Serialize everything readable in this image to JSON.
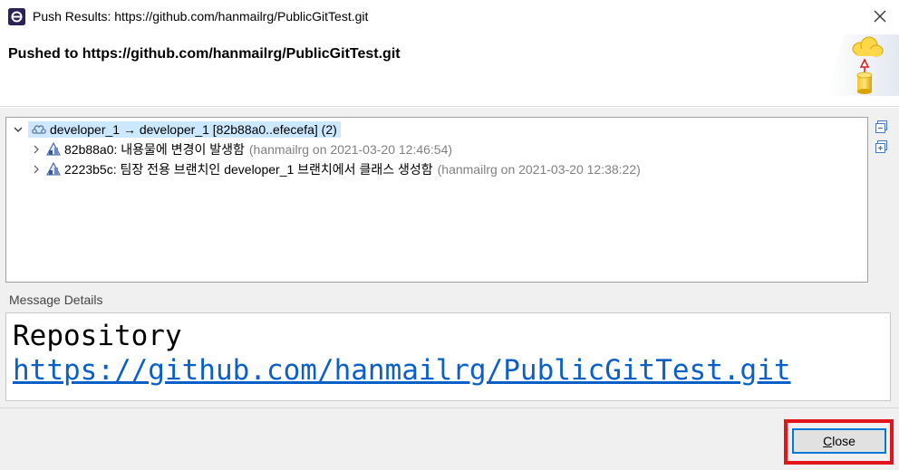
{
  "window": {
    "title": "Push Results: https://github.com/hanmailrg/PublicGitTest.git",
    "app_icon": "eclipse-icon",
    "close_icon": "close-icon"
  },
  "header": {
    "title": "Pushed to https://github.com/hanmailrg/PublicGitTest.git",
    "graphic": "cloud-push-icon"
  },
  "tree": {
    "root": {
      "label": "developer_1 → developer_1 [82b88a0..efecefa] (2)",
      "icon": "branch-icon",
      "expanded": true
    },
    "commits": [
      {
        "message": "82b88a0: 내용물에 변경이 발생함",
        "meta": "(hanmailrg on 2021-03-20 12:46:54)",
        "icon": "commit-icon"
      },
      {
        "message": "2223b5c: 팀장 전용 브랜치인 developer_1 브랜치에서 클래스 생성함",
        "meta": "(hanmailrg on 2021-03-20 12:38:22)",
        "icon": "commit-icon"
      }
    ],
    "side_buttons": [
      "collapse-all-icon",
      "expand-all-icon"
    ]
  },
  "message_details": {
    "label": "Message Details",
    "line1": "Repository",
    "line2": "https://github.com/hanmailrg/PublicGitTest.git"
  },
  "footer": {
    "close_underlined": "C",
    "close_rest": "lose"
  },
  "colors": {
    "selection": "#cce8ff",
    "link": "#0b60c8",
    "highlight_border": "#e3151a",
    "focus_border": "#0078d7"
  }
}
